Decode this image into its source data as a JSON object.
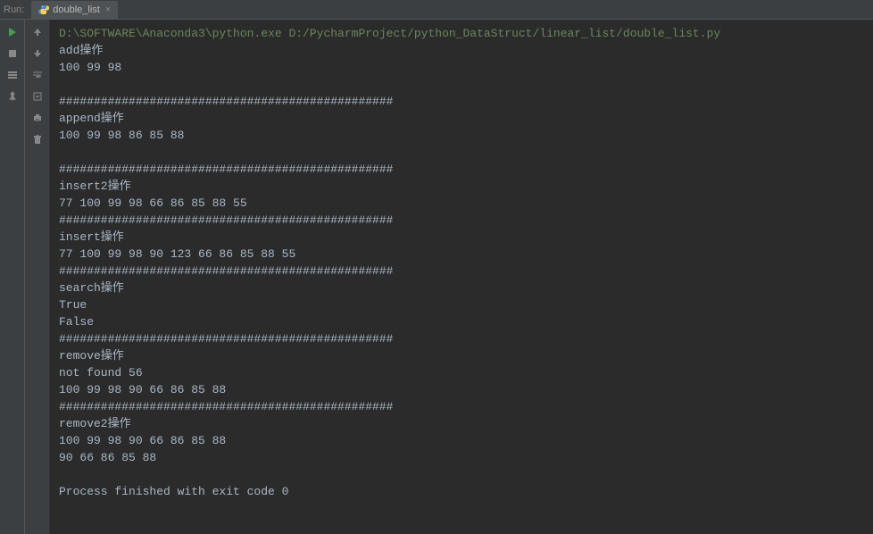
{
  "header": {
    "run_label": "Run:",
    "tab_name": "double_list",
    "tab_close": "×"
  },
  "console": {
    "lines": [
      {
        "text": "D:\\SOFTWARE\\Anaconda3\\python.exe D:/PycharmProject/python_DataStruct/linear_list/double_list.py",
        "type": "command"
      },
      {
        "text": "add操作",
        "type": "output"
      },
      {
        "text": "100 99 98",
        "type": "output"
      },
      {
        "text": "",
        "type": "output"
      },
      {
        "text": "################################################",
        "type": "output"
      },
      {
        "text": "append操作",
        "type": "output"
      },
      {
        "text": "100 99 98 86 85 88",
        "type": "output"
      },
      {
        "text": "",
        "type": "output"
      },
      {
        "text": "################################################",
        "type": "output"
      },
      {
        "text": "insert2操作",
        "type": "output"
      },
      {
        "text": "77 100 99 98 66 86 85 88 55",
        "type": "output"
      },
      {
        "text": "################################################",
        "type": "output"
      },
      {
        "text": "insert操作",
        "type": "output"
      },
      {
        "text": "77 100 99 98 90 123 66 86 85 88 55",
        "type": "output"
      },
      {
        "text": "################################################",
        "type": "output"
      },
      {
        "text": "search操作",
        "type": "output"
      },
      {
        "text": "True",
        "type": "output"
      },
      {
        "text": "False",
        "type": "output"
      },
      {
        "text": "################################################",
        "type": "output"
      },
      {
        "text": "remove操作",
        "type": "output"
      },
      {
        "text": "not found 56",
        "type": "output"
      },
      {
        "text": "100 99 98 90 66 86 85 88",
        "type": "output"
      },
      {
        "text": "################################################",
        "type": "output"
      },
      {
        "text": "remove2操作",
        "type": "output"
      },
      {
        "text": "100 99 98 90 66 86 85 88",
        "type": "output"
      },
      {
        "text": "90 66 86 85 88",
        "type": "output"
      },
      {
        "text": "",
        "type": "output"
      },
      {
        "text": "Process finished with exit code 0",
        "type": "output"
      }
    ]
  }
}
